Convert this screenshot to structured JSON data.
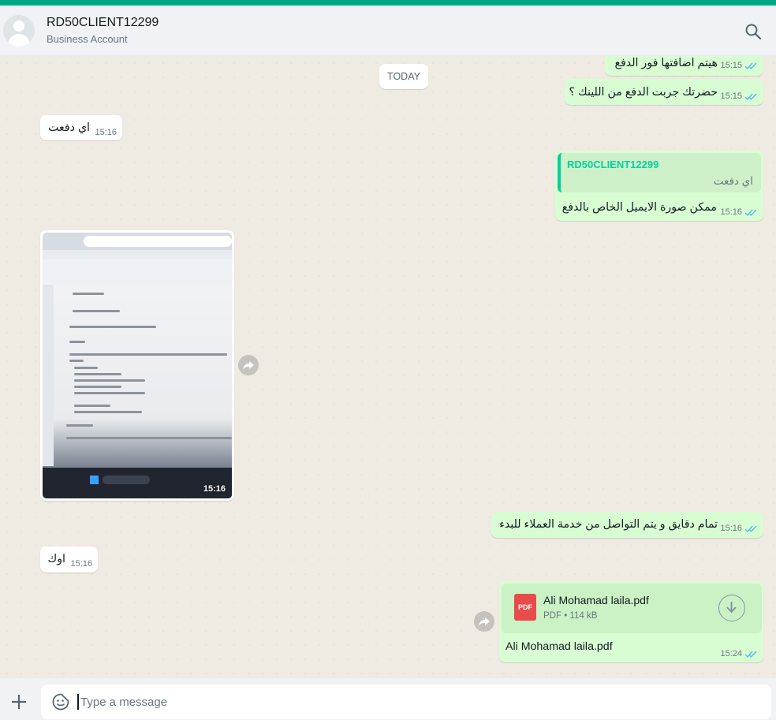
{
  "header": {
    "contact_name": "RD50CLIENT12299",
    "contact_subtitle": "Business Account",
    "search_icon": "search-icon",
    "avatar_icon": "default-avatar-icon"
  },
  "chat": {
    "date_divider": "TODAY",
    "messages": [
      {
        "direction": "out",
        "text": "هيتم اضافتها فور الدفع",
        "time": "15:15",
        "status": "read"
      },
      {
        "direction": "out",
        "text": "حضرتك جربت الدفع من اللينك ؟",
        "time": "15:15",
        "status": "read"
      },
      {
        "direction": "in",
        "text": "اي دفعت",
        "time": "15:16"
      },
      {
        "direction": "out",
        "quote": {
          "author": "RD50CLIENT12299",
          "text": "اي دفعت"
        },
        "text": "ممكن صورة الايميل الخاص بالدفع",
        "time": "15:16",
        "status": "read"
      },
      {
        "direction": "in",
        "type": "image",
        "time": "15:16"
      },
      {
        "direction": "out",
        "text": "تمام دقايق و يتم التواصل من خدمة العملاء للبدء",
        "time": "15:16",
        "status": "read"
      },
      {
        "direction": "in",
        "text": "اوك",
        "time": "15:16"
      },
      {
        "direction": "out",
        "type": "document",
        "file_name": "Ali Mohamad laila.pdf",
        "file_type": "PDF",
        "file_size": "114 kB",
        "file_icon_label": "PDF",
        "caption": "Ali Mohamad laila.pdf",
        "time": "15:24",
        "status": "read"
      }
    ],
    "doc_info": "PDF • 114 kB"
  },
  "composer": {
    "placeholder": "Type a message",
    "value": ""
  },
  "colors": {
    "accent": "#00a884",
    "outgoing_bubble": "#d9fdd3",
    "incoming_bubble": "#ffffff",
    "read_ticks": "#53bdeb",
    "quote_author": "#06cf9c",
    "pdf_icon": "#e94b4b"
  }
}
